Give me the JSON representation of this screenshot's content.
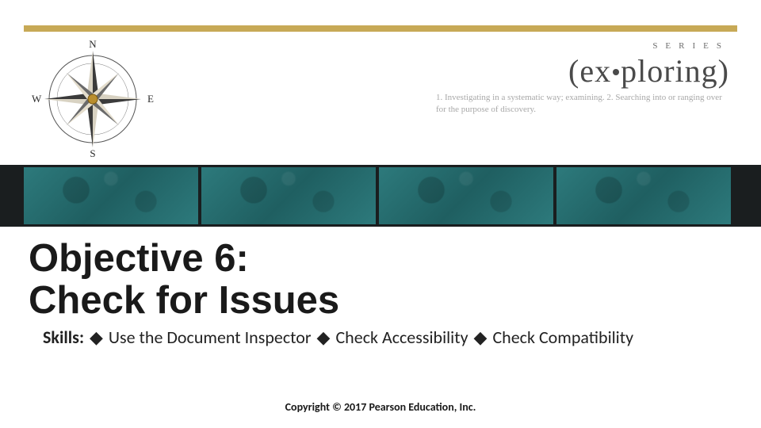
{
  "compass": {
    "n": "N",
    "e": "E",
    "s": "S",
    "w": "W"
  },
  "brand": {
    "series": "SERIES",
    "title_open": "(ex",
    "title_close": "ploring)",
    "definition": "1. Investigating in a systematic way; examining. 2. Searching into or ranging over for the purpose of discovery."
  },
  "objective": {
    "line1": "Objective 6:",
    "line2": "Check for Issues"
  },
  "skills": {
    "label": "Skills:",
    "bullet": "◆",
    "item1": "Use the Document Inspector",
    "item2": "Check Accessibility",
    "item3": "Check Compatibility"
  },
  "footer": {
    "copyright": "Copyright © 2017 Pearson Education, Inc."
  }
}
